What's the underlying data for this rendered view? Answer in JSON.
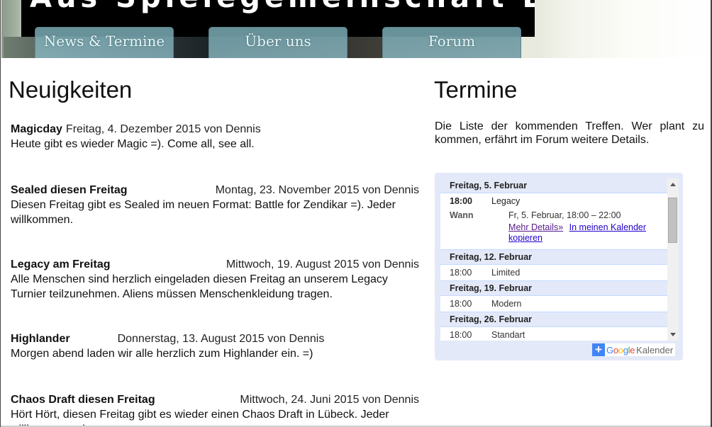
{
  "header": {
    "site_title": "Aus Spielegemeinschaft Lübeck",
    "nav": [
      {
        "label": "News & Termine"
      },
      {
        "label": "Über uns"
      },
      {
        "label": "Forum"
      }
    ]
  },
  "news": {
    "heading": "Neuigkeiten",
    "posts": [
      {
        "title": "Magicday",
        "meta": "Freitag, 4. Dezember 2015 von Dennis",
        "body": "Heute gibt es wieder Magic =). Come all, see all."
      },
      {
        "title": "Sealed diesen Freitag",
        "meta": "Montag, 23. November 2015 von Dennis",
        "body": "Diesen Freitag gibt es Sealed im neuen Format: Battle for Zendikar =). Jeder willkommen."
      },
      {
        "title": "Legacy am Freitag",
        "meta": "Mittwoch, 19. August 2015 von Dennis",
        "body": "Alle Menschen sind herzlich eingeladen diesen Freitag an unserem Legacy Turnier teilzunehmen. Aliens müssen Menschenkleidung tragen."
      },
      {
        "title": "Highlander",
        "meta": "Donnerstag, 13. August 2015 von Dennis",
        "body": "Morgen abend laden wir alle herzlich zum Highlander ein. =)"
      },
      {
        "title": "Chaos Draft diesen Freitag",
        "meta": "Mittwoch, 24. Juni 2015 von Dennis",
        "body": "Hört Hört, diesen Freitag gibt es wieder einen Chaos Draft in Lübeck. Jeder willkommen. =)"
      }
    ]
  },
  "termine": {
    "heading": "Termine",
    "intro": "Die Liste der kommenden Treffen. Wer plant zu kommen, erfährt im Forum weitere Details.",
    "calendar": {
      "days": [
        {
          "date": "Freitag, 5. Februar",
          "time": "18:00",
          "event": "Legacy",
          "wann_label": "Wann",
          "wann_value": "Fr, 5. Februar, 18:00 – 22:00",
          "more_details": "Mehr Details»",
          "copy_link": "In meinen Kalender kopieren"
        },
        {
          "date": "Freitag, 12. Februar",
          "time": "18:00",
          "event": "Limited"
        },
        {
          "date": "Freitag, 19. Februar",
          "time": "18:00",
          "event": "Modern"
        },
        {
          "date": "Freitag, 26. Februar",
          "time": "18:00",
          "event": "Standart"
        }
      ],
      "google_letters": [
        "G",
        "o",
        "o",
        "g",
        "l",
        "e"
      ],
      "kalender_label": "Kalender",
      "plus_label": "+"
    }
  }
}
